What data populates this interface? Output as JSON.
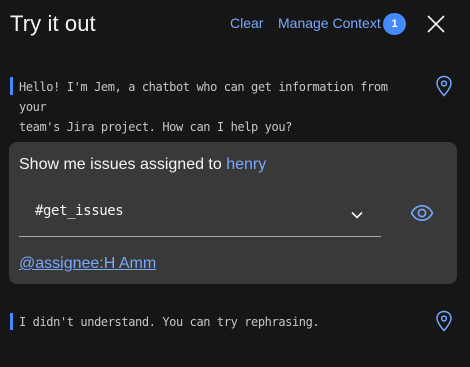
{
  "header": {
    "title": "Try it out",
    "clear_label": "Clear",
    "manage_context_label": "Manage Context",
    "context_count": "1"
  },
  "messages": [
    {
      "type": "bot",
      "lines": [
        "Hello! I'm Jem, a chatbot who can get information from your",
        "team's Jira project. How can I help you?"
      ]
    },
    {
      "type": "user",
      "text_before": "Show me issues assigned to ",
      "entity_text": "henry",
      "intent": "#get_issues",
      "entity_link": "@assignee:H Amm"
    },
    {
      "type": "bot",
      "lines": [
        "I didn't understand. You can try rephrasing."
      ]
    }
  ],
  "colors": {
    "background": "#161616",
    "card": "#393939",
    "accent": "#78a9ff",
    "badge": "#4589ff",
    "bot_bar": "#4589ff"
  },
  "icons": {
    "close": "close-icon",
    "location": "location-pin-icon",
    "chevron": "chevron-down-icon",
    "view": "eye-icon"
  }
}
